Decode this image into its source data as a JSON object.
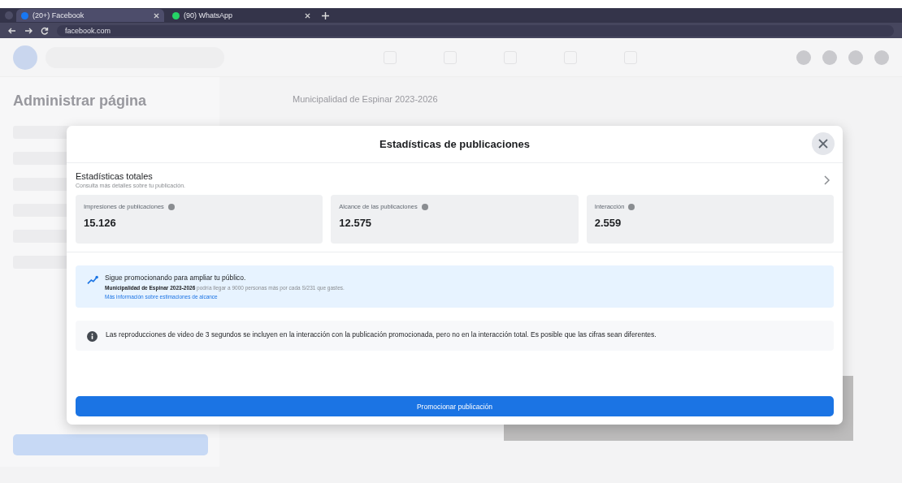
{
  "browser": {
    "tabs": [
      {
        "title": "(20+) Facebook",
        "selected": true,
        "kind": "facebook"
      },
      {
        "title": "(90) WhatsApp",
        "selected": false,
        "kind": "whatsapp"
      }
    ],
    "url": "facebook.com"
  },
  "page": {
    "sidebar_title": "Administrar página",
    "page_name": "Municipalidad de Espinar 2023-2026"
  },
  "dialog": {
    "title": "Estadísticas de publicaciones",
    "section_title": "Estadísticas totales",
    "section_subtitle": "Consulta más detalles sobre tu publicación.",
    "stats": [
      {
        "label": "Impresiones de publicaciones",
        "value": "15.126"
      },
      {
        "label": "Alcance de las publicaciones",
        "value": "12.575"
      },
      {
        "label": "Interacción",
        "value": "2.559"
      }
    ],
    "promo": {
      "title": "Sigue promocionando para ampliar tu público.",
      "body": "**Municipalidad de Espinar 2023-2026** podría llegar a 9000 personas más por cada S/231 que gastes.",
      "link": "Más información sobre estimaciones de alcance"
    },
    "note": "Las reproducciones de video de 3 segundos se incluyen en la interacción con la publicación promocionada, pero no en la interacción total. Es posible que las cifras sean diferentes.",
    "button": "Promocionar publicación"
  }
}
